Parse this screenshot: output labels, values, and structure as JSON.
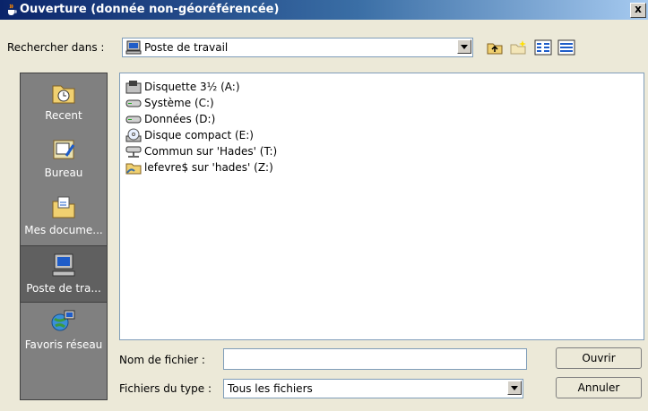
{
  "window": {
    "title": "Ouverture (donnée non-géoréférencée)",
    "close_label": "x"
  },
  "look_in": {
    "label": "Rechercher dans :",
    "value": "Poste de travail",
    "icon": "computer-icon"
  },
  "toolbar": [
    {
      "name": "up-folder-icon"
    },
    {
      "name": "new-folder-icon"
    },
    {
      "name": "list-view-icon"
    },
    {
      "name": "details-view-icon"
    }
  ],
  "sidebar": {
    "items": [
      {
        "label": "Recent",
        "icon": "recent-folder-icon",
        "selected": false
      },
      {
        "label": "Bureau",
        "icon": "desktop-icon",
        "selected": false
      },
      {
        "label": "Mes docume...",
        "icon": "my-documents-icon",
        "selected": false
      },
      {
        "label": "Poste de tra...",
        "icon": "computer-icon",
        "selected": true
      },
      {
        "label": "Favoris réseau",
        "icon": "network-icon",
        "selected": false
      }
    ]
  },
  "files": [
    {
      "label": "Disquette 3½ (A:)",
      "icon": "floppy-icon"
    },
    {
      "label": "Système (C:)",
      "icon": "hard-drive-icon"
    },
    {
      "label": "Données (D:)",
      "icon": "hard-drive-icon"
    },
    {
      "label": "Disque compact (E:)",
      "icon": "cd-drive-icon"
    },
    {
      "label": "Commun sur 'Hades' (T:)",
      "icon": "network-drive-icon"
    },
    {
      "label": "lefevre$ sur 'hades' (Z:)",
      "icon": "shared-folder-icon"
    }
  ],
  "filename": {
    "label": "Nom de fichier :",
    "value": ""
  },
  "filetype": {
    "label": "Fichiers du type :",
    "value": "Tous les fichiers"
  },
  "buttons": {
    "open": "Ouvrir",
    "cancel": "Annuler"
  }
}
